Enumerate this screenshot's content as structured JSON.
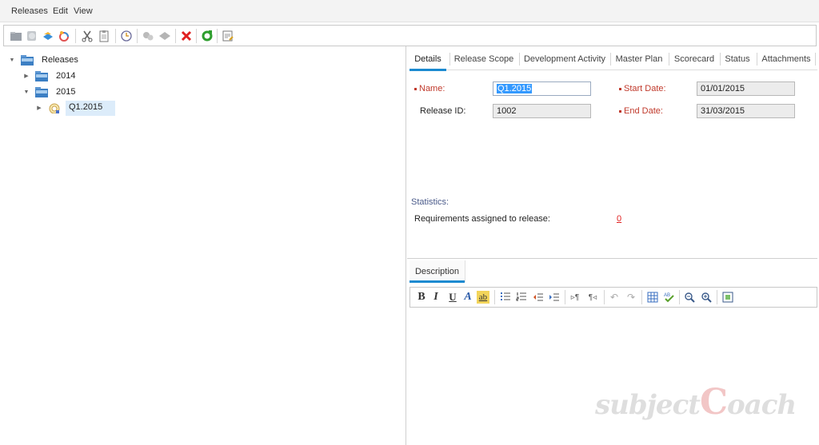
{
  "menubar": {
    "items": [
      "Releases",
      "Edit",
      "View"
    ]
  },
  "toolbar": {
    "buttons": [
      {
        "icon": "new-folder-icon"
      },
      {
        "icon": "new-release-icon"
      },
      {
        "icon": "new-cycle-icon"
      },
      {
        "icon": "assign-icon"
      },
      {
        "icon": "cut-icon"
      },
      {
        "icon": "paste-icon"
      },
      {
        "icon": "schedule-icon"
      },
      {
        "icon": "gear-group-icon"
      },
      {
        "icon": "tag-icon"
      },
      {
        "icon": "delete-icon",
        "color": "#e02020"
      },
      {
        "icon": "refresh-icon",
        "color": "#2e9e2e"
      },
      {
        "icon": "edit-note-icon"
      }
    ]
  },
  "tree": {
    "root": "Releases",
    "nodes": [
      {
        "label": "2014",
        "expanded": false
      },
      {
        "label": "2015",
        "expanded": true
      },
      {
        "label": "Q1.2015",
        "selected": true
      }
    ]
  },
  "tabs": [
    "Details",
    "Release Scope",
    "Development Activity",
    "Master Plan",
    "Scorecard",
    "Status",
    "Attachments"
  ],
  "active_tab": "Details",
  "details": {
    "name_label": "Name:",
    "name_value": "Q1.2015",
    "release_id_label": "Release ID:",
    "release_id_value": "1002",
    "start_date_label": "Start Date:",
    "start_date_value": "01/01/2015",
    "end_date_label": "End Date:",
    "end_date_value": "31/03/2015"
  },
  "statistics": {
    "title": "Statistics:",
    "requirements_label": "Requirements assigned to release:",
    "requirements_value": "0"
  },
  "description": {
    "tab_label": "Description",
    "toolbar": {
      "bold": "B",
      "italic": "I",
      "underline": "U",
      "font_color": "A",
      "highlight": "ab"
    }
  },
  "watermark": {
    "part1": "subject",
    "part2": "C",
    "part3": "oach"
  },
  "colors": {
    "accent": "#1b8ad0",
    "required": "#c0392b",
    "link_red": "#e02020",
    "selection": "#dcecfa"
  }
}
